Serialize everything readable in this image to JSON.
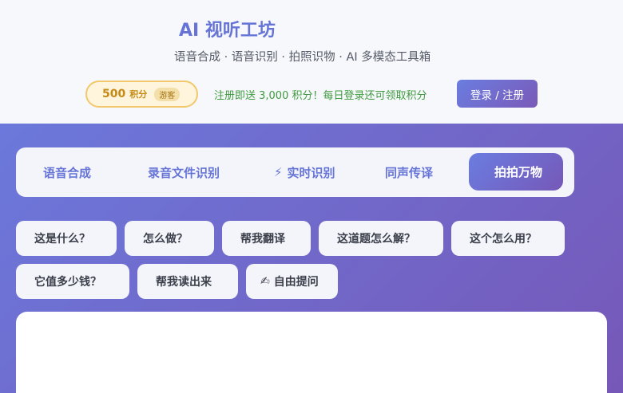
{
  "header": {
    "title_icon": "",
    "title_icon_name": "movie-camera-icon",
    "title": "AI 视听工坊",
    "subtitle": "语音合成 · 语音识别 · 拍照识物 · AI 多模态工具箱",
    "points": {
      "icon": "",
      "icon_name": "coin-icon",
      "value": "500",
      "unit": "积分",
      "role": "游客"
    },
    "promo": {
      "icon": "",
      "icon_name": "gift-icon",
      "text": "注册即送 3,000 积分！每日登录还可领取积分"
    },
    "login_label": "登录 / 注册"
  },
  "tabs": [
    {
      "icon": "",
      "icon_name": "speaker-icon",
      "label": "语音合成",
      "active": false
    },
    {
      "icon": "",
      "icon_name": "folder-icon",
      "label": "录音文件识别",
      "active": false
    },
    {
      "icon": "⚡",
      "icon_name": "lightning-icon",
      "label": "实时识别",
      "active": false
    },
    {
      "icon": "",
      "icon_name": "translate-icon",
      "label": "同声传译",
      "active": false
    },
    {
      "icon": "",
      "icon_name": "camera-icon",
      "label": "拍拍万物",
      "active": true
    }
  ],
  "prompts": [
    {
      "icon": "",
      "icon_name": "question-icon",
      "label": "这是什么？"
    },
    {
      "icon": "",
      "icon_name": "cooking-icon",
      "label": "怎么做？"
    },
    {
      "icon": "",
      "icon_name": "globe-icon",
      "label": "帮我翻译"
    },
    {
      "icon": "",
      "icon_name": "pencil-icon",
      "label": "这道题怎么解？"
    },
    {
      "icon": "",
      "icon_name": "wrench-icon",
      "label": "这个怎么用？"
    },
    {
      "icon": "",
      "icon_name": "money-icon",
      "label": "它值多少钱？"
    },
    {
      "icon": "",
      "icon_name": "book-icon",
      "label": "帮我读出来"
    },
    {
      "icon": "✍",
      "icon_name": "writing-hand-icon",
      "label": "自由提问"
    }
  ],
  "panel": {
    "icon": "",
    "icon_name": "camera-icon"
  }
}
